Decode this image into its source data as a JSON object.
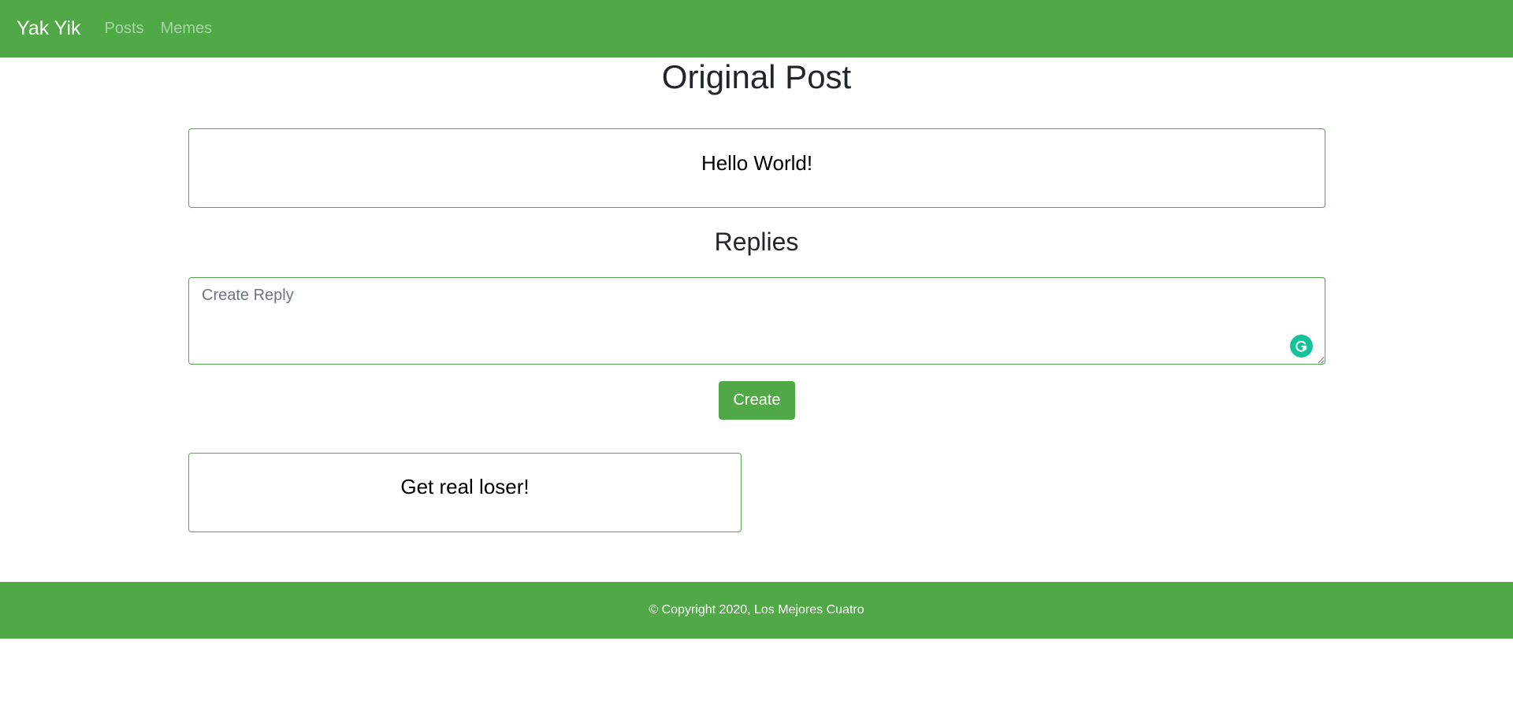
{
  "colors": {
    "brand_green": "#50a846",
    "grammarly_green": "#15c39a"
  },
  "navbar": {
    "brand": "Yak Yik",
    "links": [
      {
        "label": "Posts"
      },
      {
        "label": "Memes"
      }
    ]
  },
  "main": {
    "title": "Original Post",
    "post_text": "Hello World!",
    "replies_title": "Replies",
    "reply_input": {
      "placeholder": "Create Reply",
      "value": ""
    },
    "create_label": "Create",
    "replies": [
      {
        "text": "Get real loser!"
      }
    ],
    "extension_icon": "grammarly-icon"
  },
  "footer": {
    "text": "© Copyright 2020, Los Mejores Cuatro"
  }
}
